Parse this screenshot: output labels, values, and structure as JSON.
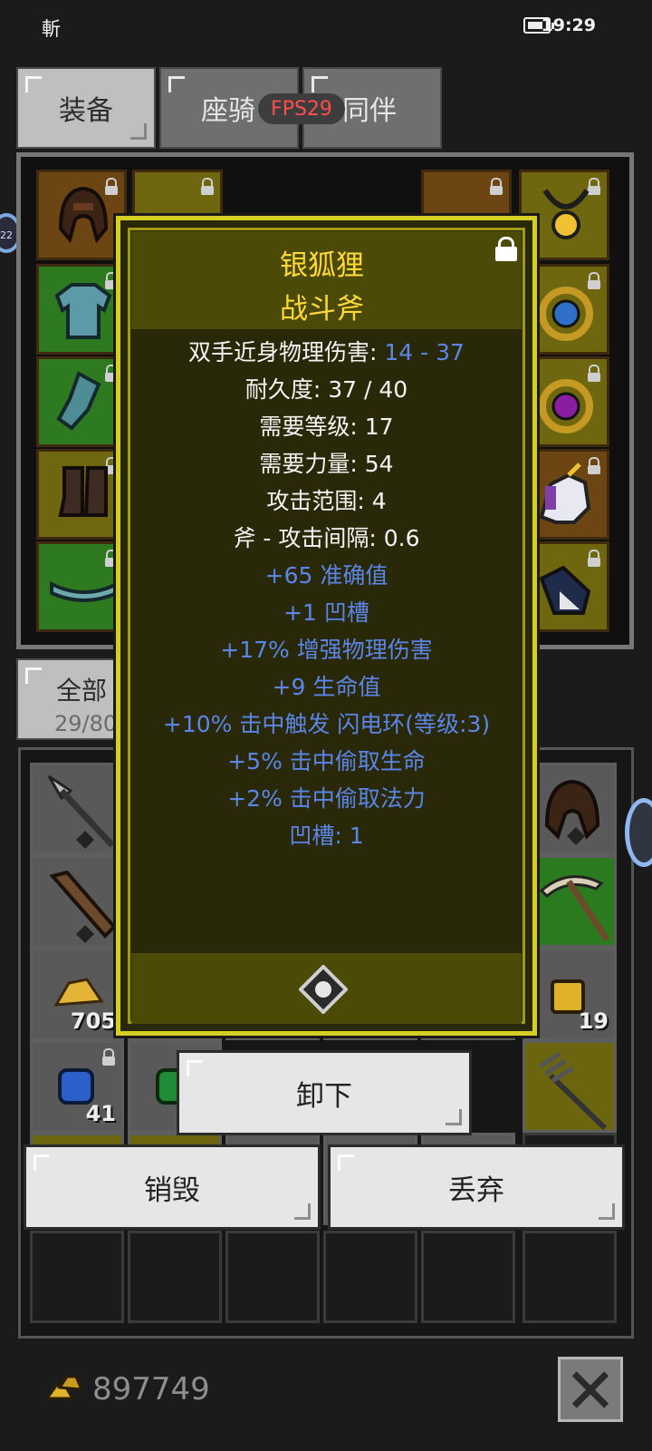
{
  "status_bar": {
    "left_text": "斬",
    "time": "19:29"
  },
  "tabs": [
    {
      "label": "装备"
    },
    {
      "label": "座骑"
    },
    {
      "label": "同伴"
    }
  ],
  "fps_badge": "FPS29",
  "side_badge": "22",
  "bag": {
    "tab_label": "全部",
    "count": "29/80"
  },
  "cell_counts": [
    "705",
    "19",
    "41"
  ],
  "item_tooltip": {
    "name": "银狐狸",
    "type": "战斗斧",
    "damage_label": "双手近身物理伤害: ",
    "damage_value": "14 - 37",
    "stats": [
      "耐久度: 37 / 40",
      "需要等级: 17",
      "需要力量: 54",
      "攻击范围: 4",
      "斧 - 攻击间隔: 0.6"
    ],
    "mods": [
      "+65 准确值",
      "+1 凹槽",
      "+17% 增强物理伤害",
      "+9 生命值",
      "+10% 击中触发 闪电环(等级:3)",
      "+5% 击中偷取生命",
      "+2% 击中偷取法力",
      "凹槽: 1"
    ]
  },
  "actions": {
    "unequip": "卸下",
    "destroy": "销毁",
    "drop": "丢弃"
  },
  "gold": "897749",
  "colors": {
    "tooltip_title": "#ffd83a",
    "tooltip_border": "#d6ce22",
    "mod_blue": "#5b86e8",
    "fps_red": "#ff4c4c"
  }
}
